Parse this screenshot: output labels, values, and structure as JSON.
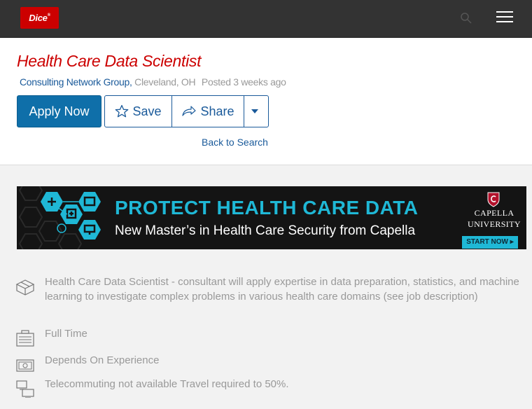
{
  "topbar": {
    "logo_text": "Dice",
    "logo_mark": "®",
    "search_icon": "search-icon",
    "menu_icon": "hamburger-menu-icon",
    "logo_color": "#cc0000",
    "bar_color": "#333333"
  },
  "job": {
    "title": "Health Care Data Scientist",
    "company": "Consulting Network Group,",
    "location": "Cleveland, OH",
    "posted": "Posted 3 weeks ago"
  },
  "actions": {
    "apply_label": "Apply Now",
    "save_label": "Save",
    "share_label": "Share",
    "back_label": "Back to Search",
    "accent_color": "#0f6fa9"
  },
  "banner": {
    "headline": "PROTECT HEALTH CARE DATA",
    "subline": "New Master’s in Health Care Security from Capella",
    "university_line1": "CAPELLA",
    "university_line2": "UNIVERSITY",
    "cta": "START NOW ▸",
    "accent_color": "#1fb8d6"
  },
  "details": {
    "summary": "Health Care Data Scientist - consultant will apply expertise in data preparation, statistics, and machine learning to investigate complex problems in various health care domains (see job description)",
    "employment_type": "Full Time",
    "salary": "Depends On Experience",
    "travel": "Telecommuting not available Travel required to 50%.",
    "icons": [
      "skills-box-icon",
      "briefcase-icon",
      "money-icon",
      "telecommute-icon"
    ]
  }
}
